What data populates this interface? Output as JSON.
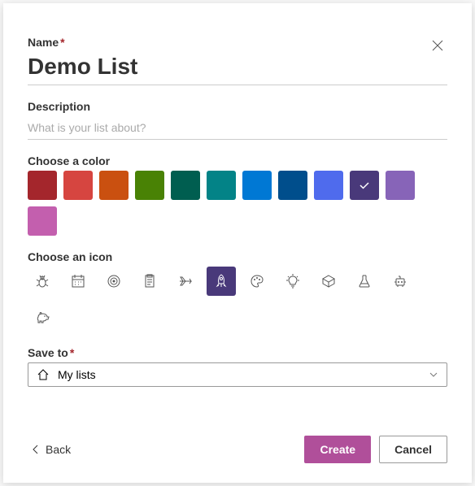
{
  "labels": {
    "name": "Name",
    "description": "Description",
    "choose_color": "Choose a color",
    "choose_icon": "Choose an icon",
    "save_to": "Save to",
    "required_mark": "*"
  },
  "name_value": "Demo List",
  "description_placeholder": "What is your list about?",
  "description_value": "",
  "colors": [
    {
      "name": "dark-red",
      "hex": "#a4262c",
      "selected": false
    },
    {
      "name": "red",
      "hex": "#d64540",
      "selected": false
    },
    {
      "name": "orange",
      "hex": "#ca5010",
      "selected": false
    },
    {
      "name": "green",
      "hex": "#498205",
      "selected": false
    },
    {
      "name": "dark-teal",
      "hex": "#005e50",
      "selected": false
    },
    {
      "name": "teal",
      "hex": "#038387",
      "selected": false
    },
    {
      "name": "blue",
      "hex": "#0078d4",
      "selected": false
    },
    {
      "name": "dark-blue",
      "hex": "#004e8c",
      "selected": false
    },
    {
      "name": "indigo",
      "hex": "#4f6bed",
      "selected": false
    },
    {
      "name": "dark-purple",
      "hex": "#49397a",
      "selected": true
    },
    {
      "name": "purple",
      "hex": "#8764b8",
      "selected": false
    },
    {
      "name": "pink",
      "hex": "#c35fae",
      "selected": false
    }
  ],
  "icons": [
    {
      "name": "bug",
      "selected": false
    },
    {
      "name": "calendar",
      "selected": false
    },
    {
      "name": "target",
      "selected": false
    },
    {
      "name": "clipboard",
      "selected": false
    },
    {
      "name": "airplane",
      "selected": false
    },
    {
      "name": "rocket",
      "selected": true
    },
    {
      "name": "palette",
      "selected": false
    },
    {
      "name": "lightbulb",
      "selected": false
    },
    {
      "name": "cube",
      "selected": false
    },
    {
      "name": "flask",
      "selected": false
    },
    {
      "name": "robot",
      "selected": false
    },
    {
      "name": "piggy-bank",
      "selected": false
    }
  ],
  "selected_icon_bg": "#49397a",
  "save_to_value": "My lists",
  "buttons": {
    "back": "Back",
    "create": "Create",
    "cancel": "Cancel"
  }
}
